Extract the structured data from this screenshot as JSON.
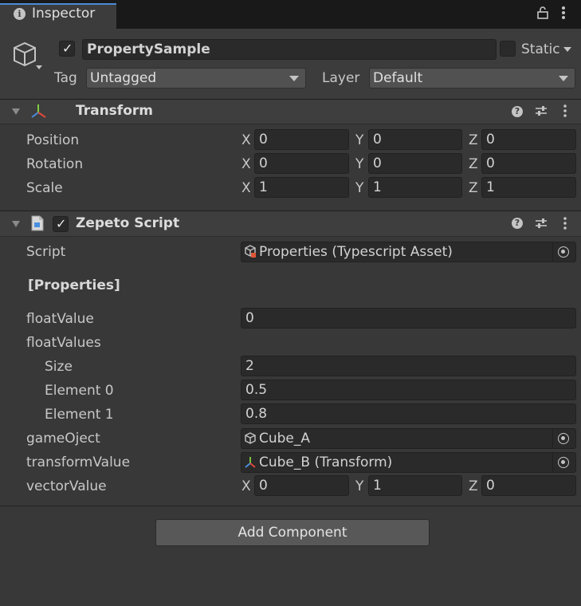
{
  "tab": {
    "title": "Inspector"
  },
  "header": {
    "object_name": "PropertySample",
    "static_label": "Static",
    "tag_label": "Tag",
    "tag_value": "Untagged",
    "layer_label": "Layer",
    "layer_value": "Default"
  },
  "transform": {
    "title": "Transform",
    "rows": [
      {
        "label": "Position",
        "x": "0",
        "y": "0",
        "z": "0"
      },
      {
        "label": "Rotation",
        "x": "0",
        "y": "0",
        "z": "0"
      },
      {
        "label": "Scale",
        "x": "1",
        "y": "1",
        "z": "1"
      }
    ]
  },
  "axis": {
    "x": "X",
    "y": "Y",
    "z": "Z"
  },
  "script": {
    "title": "Zepeto Script",
    "script_label": "Script",
    "script_value": "Properties (Typescript Asset)",
    "properties_heading": "[Properties]",
    "float_label": "floatValue",
    "float_value": "0",
    "floats_label": "floatValues",
    "size_label": "Size",
    "size_value": "2",
    "elements": [
      {
        "label": "Element 0",
        "value": "0.5"
      },
      {
        "label": "Element 1",
        "value": "0.8"
      }
    ],
    "gameobject_label": "gameOject",
    "gameobject_value": "Cube_A",
    "transform_label": "transformValue",
    "transform_value": "Cube_B (Transform)",
    "vector_label": "vectorValue",
    "vector": {
      "x": "0",
      "y": "1",
      "z": "0"
    }
  },
  "footer": {
    "add_component": "Add Component"
  },
  "colors": {
    "accent": "#4c8ad6",
    "background": "#383838",
    "header": "#3e3e3e"
  }
}
